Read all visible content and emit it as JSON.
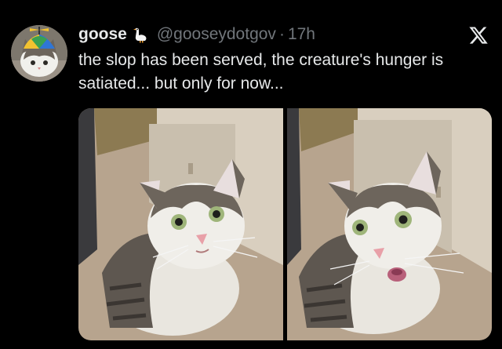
{
  "tweet": {
    "display_name": "goose",
    "handle": "@gooseydotgov",
    "separator": "·",
    "time": "17h",
    "text": "the slop has been served, the creature's hunger is satiated... but only for now..."
  },
  "icons": {
    "goose": "goose-emoji-icon",
    "platform": "x-logo-icon"
  },
  "colors": {
    "background": "#000000",
    "primary_text": "#e7e9ea",
    "secondary_text": "#71767b"
  },
  "media": {
    "count": 2
  }
}
